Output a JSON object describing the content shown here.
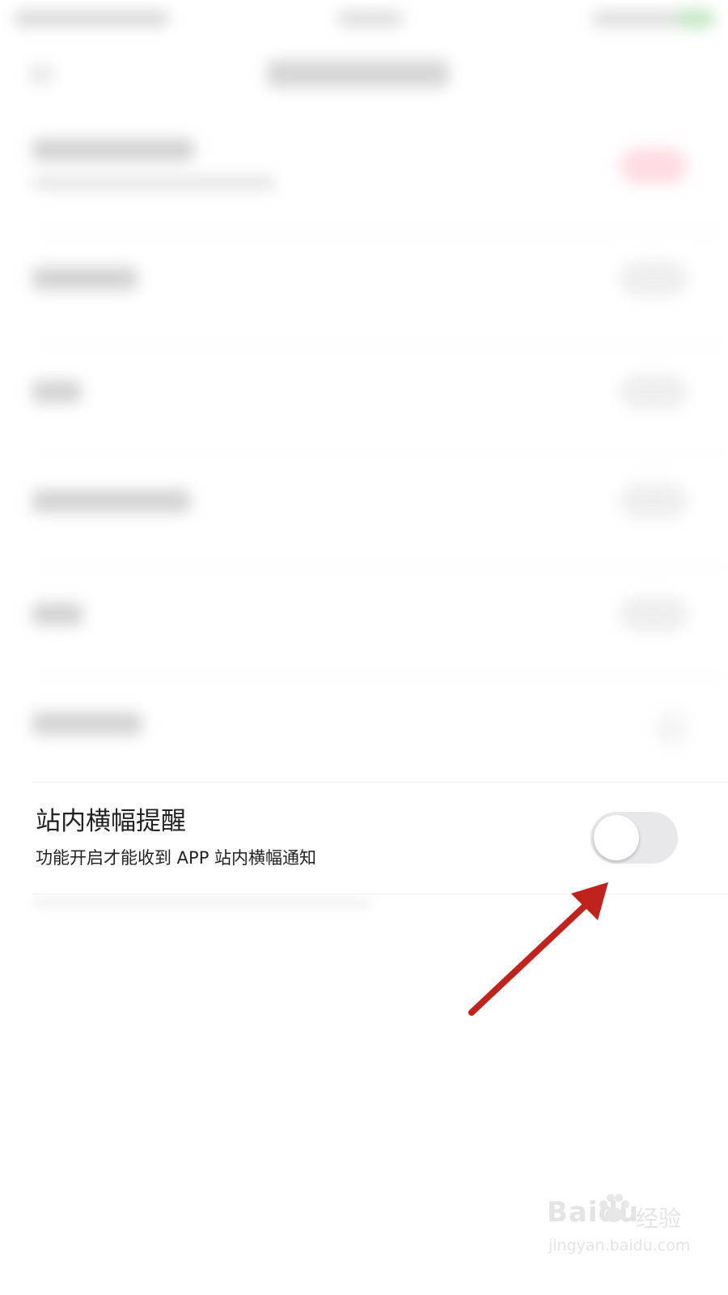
{
  "banner_setting": {
    "title": "站内横幅提醒",
    "description": "功能开启才能收到 APP 站内横幅通知",
    "toggle_state": "off",
    "toggle_track_color": "#e8e8ea",
    "toggle_knob_color": "#ffffff"
  },
  "annotation": {
    "arrow_color": "#c0221c",
    "points_to": "toggle"
  },
  "watermark": {
    "brand": "Baidu",
    "brand_cn": "经验",
    "url": "jingyan.baidu.com"
  },
  "colors": {
    "background": "#ffffff",
    "text": "#222222",
    "blurred_red_toggle": "#ffd6df",
    "blurred_battery": "#b8e0b8"
  }
}
